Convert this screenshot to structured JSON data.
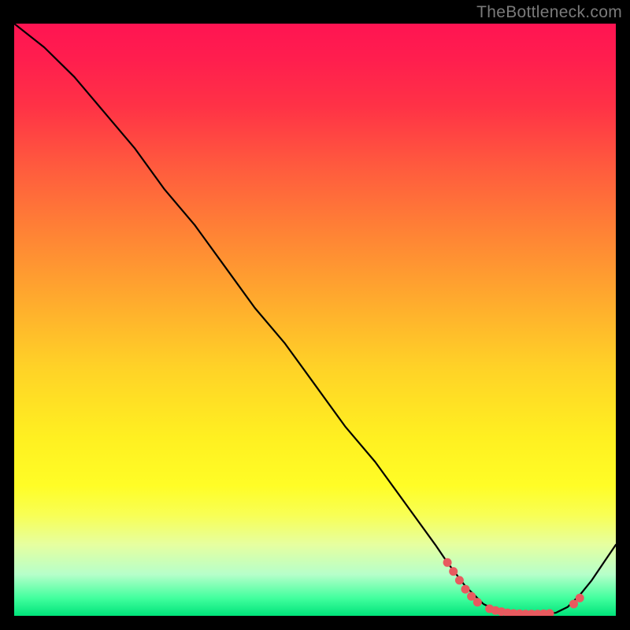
{
  "watermark": "TheBottleneck.com",
  "chart_data": {
    "type": "line",
    "title": "",
    "xlabel": "",
    "ylabel": "",
    "xlim": [
      0,
      100
    ],
    "ylim": [
      0,
      100
    ],
    "grid": false,
    "legend": "none",
    "series": [
      {
        "name": "bottleneck-curve",
        "note": "y estimated as percent of plot height from bottom; valley ~0 around x 78-90",
        "x": [
          0,
          5,
          10,
          15,
          20,
          25,
          30,
          35,
          40,
          45,
          50,
          55,
          60,
          65,
          70,
          72,
          75,
          78,
          80,
          82,
          84,
          86,
          88,
          90,
          92,
          94,
          96,
          98,
          100
        ],
        "y": [
          100,
          96,
          91,
          85,
          79,
          72,
          66,
          59,
          52,
          46,
          39,
          32,
          26,
          19,
          12,
          9,
          5,
          2,
          1,
          0.5,
          0.3,
          0.3,
          0.3,
          0.5,
          1.5,
          3.5,
          6,
          9,
          12
        ]
      }
    ],
    "markers": {
      "name": "highlight-dots",
      "color": "#e85a5f",
      "points": [
        {
          "x": 72,
          "y": 9
        },
        {
          "x": 73,
          "y": 7.5
        },
        {
          "x": 74,
          "y": 6
        },
        {
          "x": 75,
          "y": 4.5
        },
        {
          "x": 76,
          "y": 3.3
        },
        {
          "x": 77,
          "y": 2.3
        },
        {
          "x": 79,
          "y": 1.2
        },
        {
          "x": 80,
          "y": 0.9
        },
        {
          "x": 81,
          "y": 0.7
        },
        {
          "x": 82,
          "y": 0.5
        },
        {
          "x": 83,
          "y": 0.4
        },
        {
          "x": 84,
          "y": 0.35
        },
        {
          "x": 85,
          "y": 0.3
        },
        {
          "x": 86,
          "y": 0.3
        },
        {
          "x": 87,
          "y": 0.3
        },
        {
          "x": 88,
          "y": 0.35
        },
        {
          "x": 89,
          "y": 0.4
        },
        {
          "x": 93,
          "y": 2
        },
        {
          "x": 94,
          "y": 3
        }
      ]
    },
    "background": {
      "type": "vertical-gradient",
      "stops": [
        {
          "pos": 0.0,
          "color": "#ff1452"
        },
        {
          "pos": 0.7,
          "color": "#fff021"
        },
        {
          "pos": 1.0,
          "color": "#00e37a"
        }
      ]
    }
  }
}
